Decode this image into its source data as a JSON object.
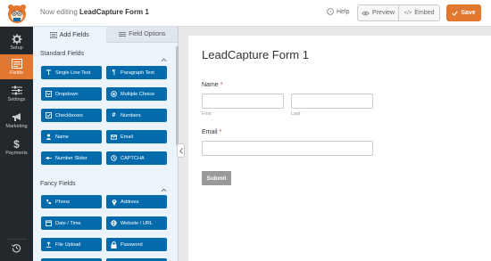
{
  "header": {
    "title_prefix": "Now editing",
    "form_name": "LeadCapture Form 1",
    "help_label": "Help",
    "preview_label": "Preview",
    "embed_label": "Embed",
    "save_label": "Save",
    "accent": "#e27730"
  },
  "nav": {
    "items": [
      {
        "label": "Setup",
        "icon": "gear-icon"
      },
      {
        "label": "Fields",
        "icon": "fields-icon",
        "active": true
      },
      {
        "label": "Settings",
        "icon": "sliders-icon"
      },
      {
        "label": "Marketing",
        "icon": "megaphone-icon"
      },
      {
        "label": "Payments",
        "icon": "dollar-icon"
      }
    ]
  },
  "panel": {
    "tabs": [
      {
        "label": "Add Fields",
        "icon": "list-icon",
        "active": true
      },
      {
        "label": "Field Options",
        "icon": "sliders-icon"
      }
    ],
    "standard_title": "Standard Fields",
    "standard_fields": [
      {
        "label": "Single Line Text",
        "icon": "text-cursor-icon"
      },
      {
        "label": "Paragraph Text",
        "icon": "paragraph-icon"
      },
      {
        "label": "Dropdown",
        "icon": "dropdown-icon"
      },
      {
        "label": "Multiple Choice",
        "icon": "radio-icon"
      },
      {
        "label": "Checkboxes",
        "icon": "checkbox-icon"
      },
      {
        "label": "Numbers",
        "icon": "hash-icon"
      },
      {
        "label": "Name",
        "icon": "user-icon"
      },
      {
        "label": "Email",
        "icon": "envelope-icon"
      },
      {
        "label": "Number Slider",
        "icon": "slider-icon"
      },
      {
        "label": "CAPTCHA",
        "icon": "captcha-icon"
      }
    ],
    "fancy_title": "Fancy Fields",
    "fancy_fields": [
      {
        "label": "Phone",
        "icon": "phone-icon"
      },
      {
        "label": "Address",
        "icon": "map-pin-icon"
      },
      {
        "label": "Date / Time",
        "icon": "calendar-icon"
      },
      {
        "label": "Website / URL",
        "icon": "link-icon"
      },
      {
        "label": "File Upload",
        "icon": "upload-icon"
      },
      {
        "label": "Password",
        "icon": "lock-icon"
      }
    ],
    "button_color": "#036aab"
  },
  "form": {
    "title": "LeadCapture Form 1",
    "name_label": "Name",
    "first_sub": "First",
    "last_sub": "Last",
    "email_label": "Email",
    "required_mark": "*",
    "submit_label": "Submit"
  }
}
